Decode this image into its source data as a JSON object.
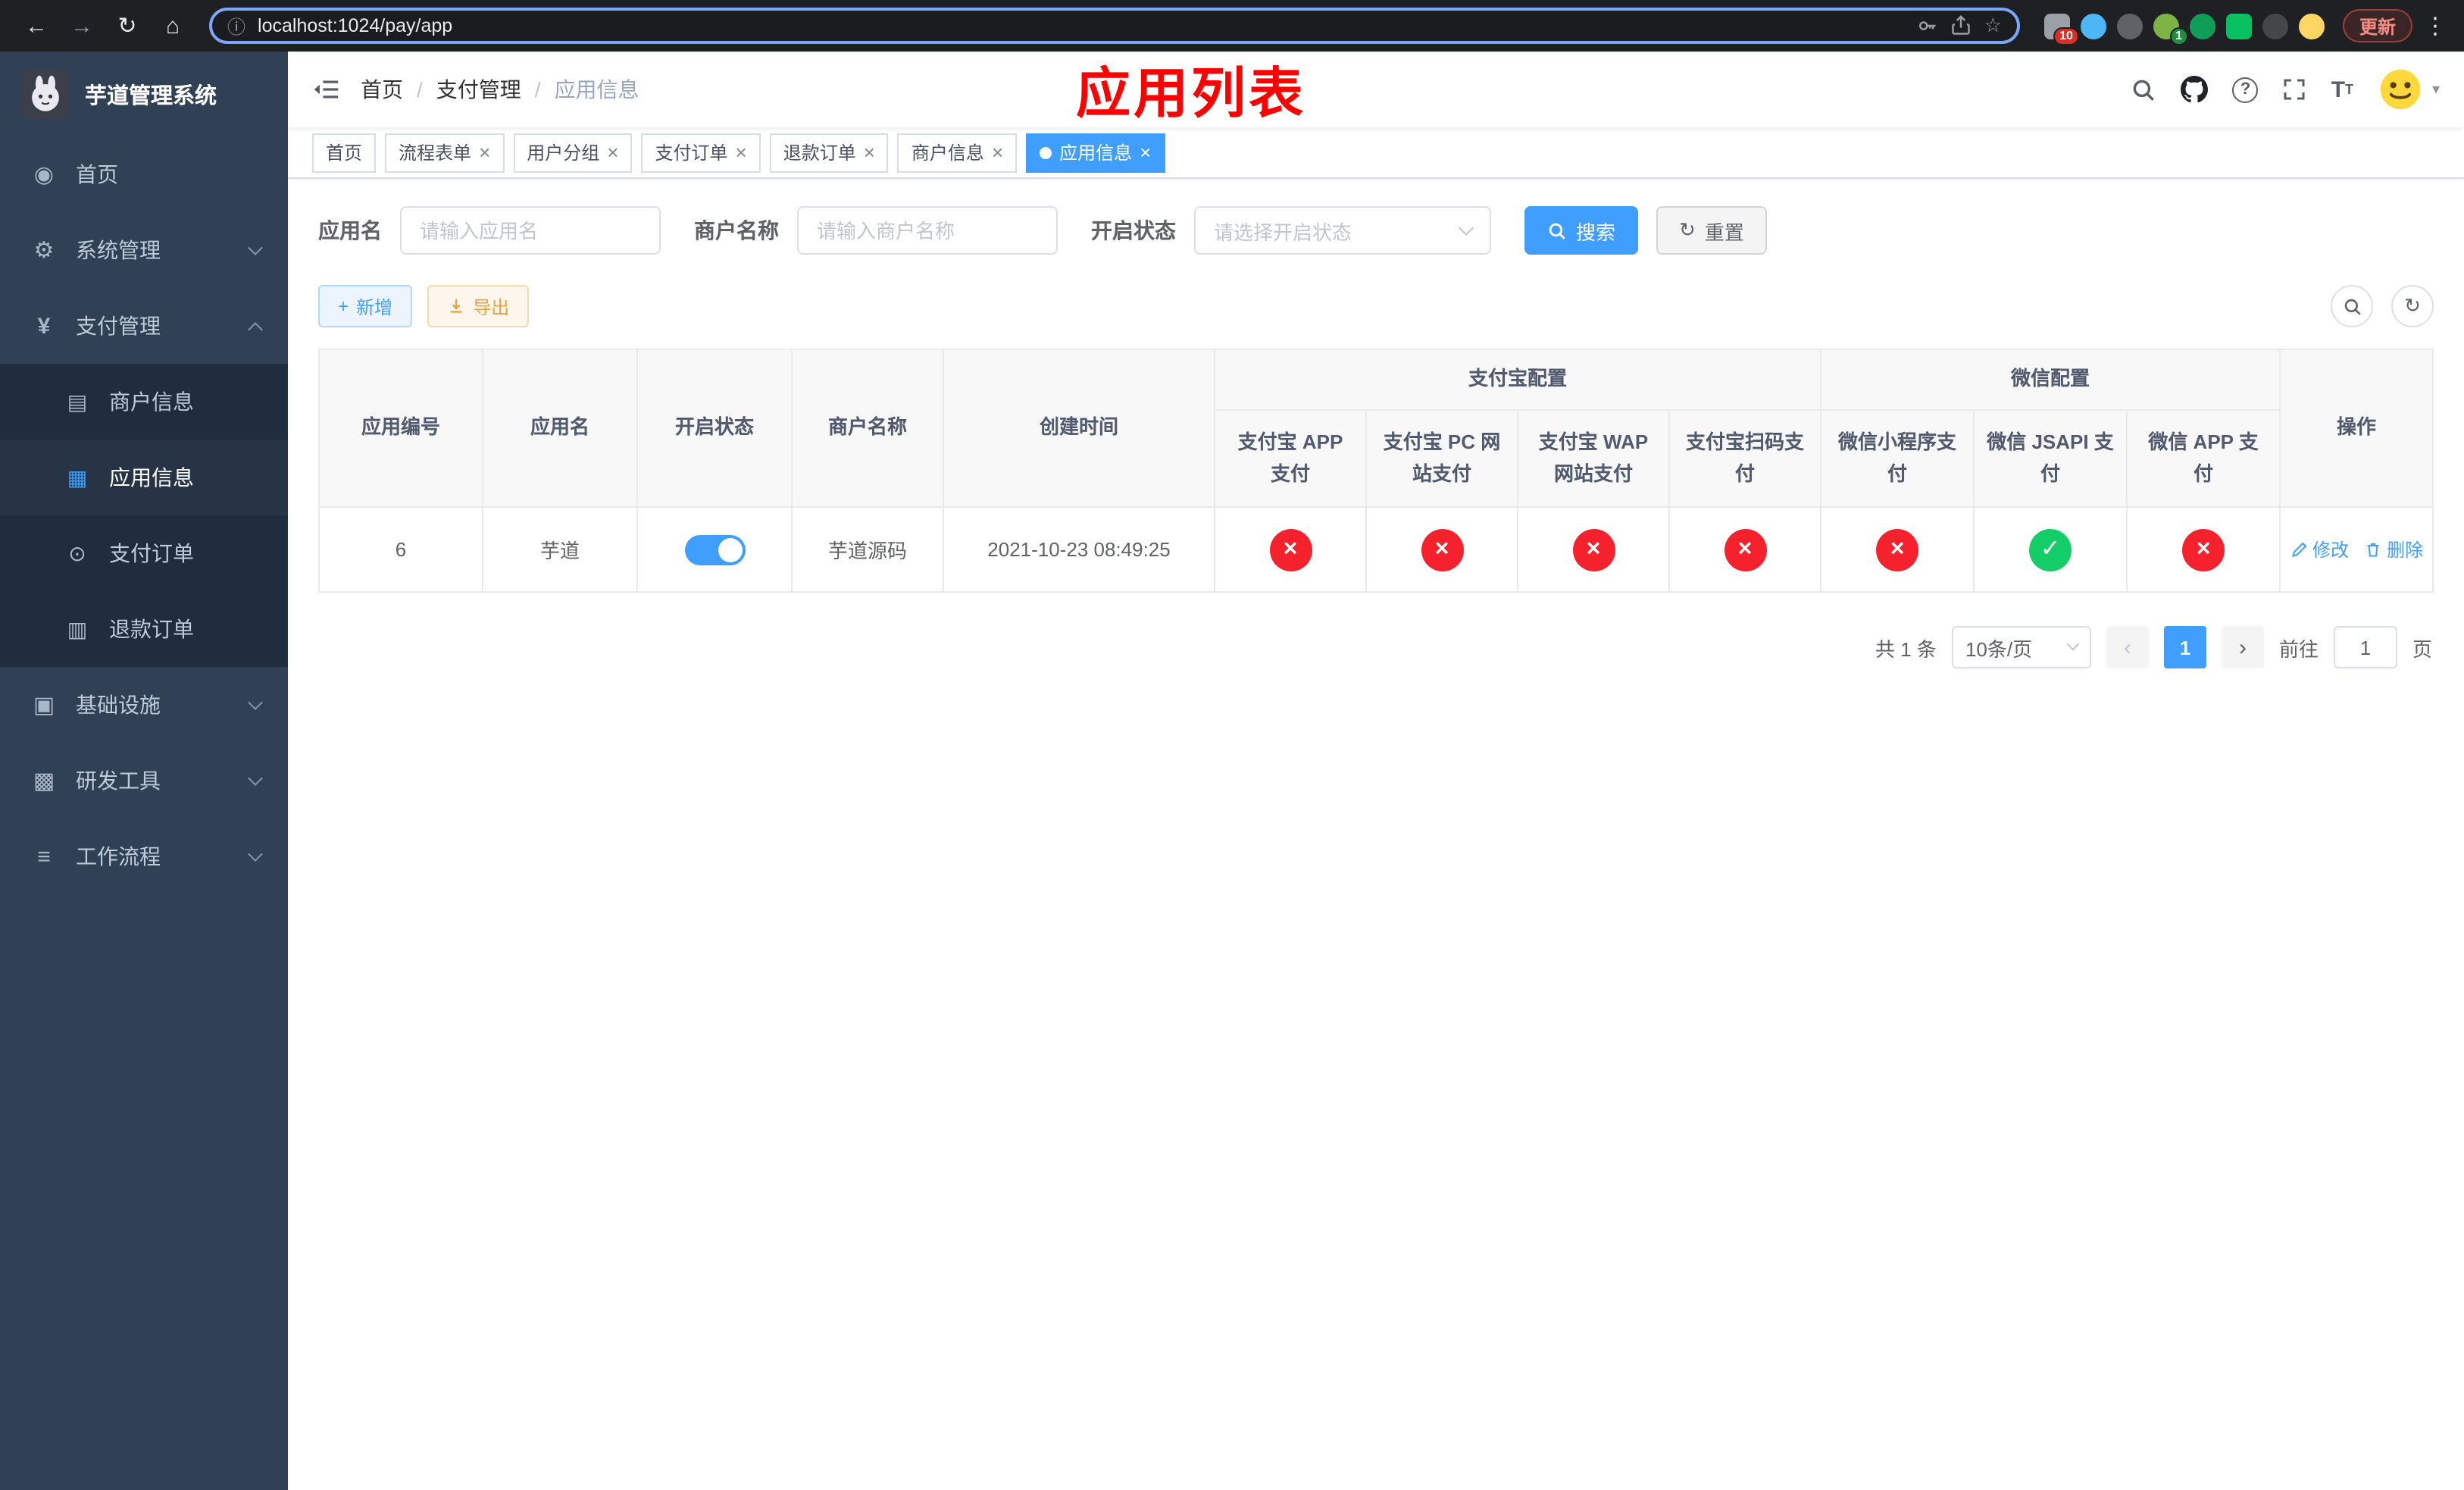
{
  "browser": {
    "url": "localhost:1024/pay/app",
    "update_label": "更新",
    "ext_badges": {
      "puzzle": "10",
      "avatar": "1"
    }
  },
  "sidebar": {
    "title": "芋道管理系统",
    "items": [
      {
        "label": "首页"
      },
      {
        "label": "系统管理"
      },
      {
        "label": "支付管理"
      },
      {
        "label": "基础设施"
      },
      {
        "label": "研发工具"
      },
      {
        "label": "工作流程"
      }
    ],
    "submenu": [
      {
        "label": "商户信息"
      },
      {
        "label": "应用信息"
      },
      {
        "label": "支付订单"
      },
      {
        "label": "退款订单"
      }
    ]
  },
  "header": {
    "breadcrumb": [
      "首页",
      "支付管理",
      "应用信息"
    ],
    "annotation": "应用列表"
  },
  "tabs": [
    {
      "label": "首页",
      "closable": false,
      "active": false
    },
    {
      "label": "流程表单",
      "closable": true,
      "active": false
    },
    {
      "label": "用户分组",
      "closable": true,
      "active": false
    },
    {
      "label": "支付订单",
      "closable": true,
      "active": false
    },
    {
      "label": "退款订单",
      "closable": true,
      "active": false
    },
    {
      "label": "商户信息",
      "closable": true,
      "active": false
    },
    {
      "label": "应用信息",
      "closable": true,
      "active": true
    }
  ],
  "filters": {
    "app_name_label": "应用名",
    "app_name_placeholder": "请输入应用名",
    "merchant_label": "商户名称",
    "merchant_placeholder": "请输入商户名称",
    "status_label": "开启状态",
    "status_placeholder": "请选择开启状态",
    "search_label": "搜索",
    "reset_label": "重置"
  },
  "toolbar": {
    "add_label": "新增",
    "export_label": "导出"
  },
  "table": {
    "headers": {
      "id": "应用编号",
      "name": "应用名",
      "status": "开启状态",
      "merchant": "商户名称",
      "created": "创建时间",
      "alipay_group": "支付宝配置",
      "wechat_group": "微信配置",
      "action": "操作",
      "alipay_cols": [
        "支付宝 APP 支付",
        "支付宝 PC 网站支付",
        "支付宝 WAP 网站支付",
        "支付宝扫码支付"
      ],
      "wechat_cols": [
        "微信小程序支付",
        "微信 JSAPI 支付",
        "微信 APP 支付"
      ]
    },
    "row": {
      "id": "6",
      "name": "芋道",
      "status_on": true,
      "merchant": "芋道源码",
      "created": "2021-10-23 08:49:25",
      "config_status": [
        "fail",
        "fail",
        "fail",
        "fail",
        "fail",
        "success",
        "fail"
      ],
      "actions": {
        "edit": "修改",
        "delete": "删除"
      }
    }
  },
  "pagination": {
    "total": "共 1 条",
    "page_size": "10条/页",
    "current": "1",
    "goto_label": "前往",
    "goto_value": "1",
    "unit": "页"
  },
  "colors": {
    "accent": "#409eff",
    "success": "#13ce66",
    "danger": "#f5222d",
    "annotation": "#ff0000"
  }
}
